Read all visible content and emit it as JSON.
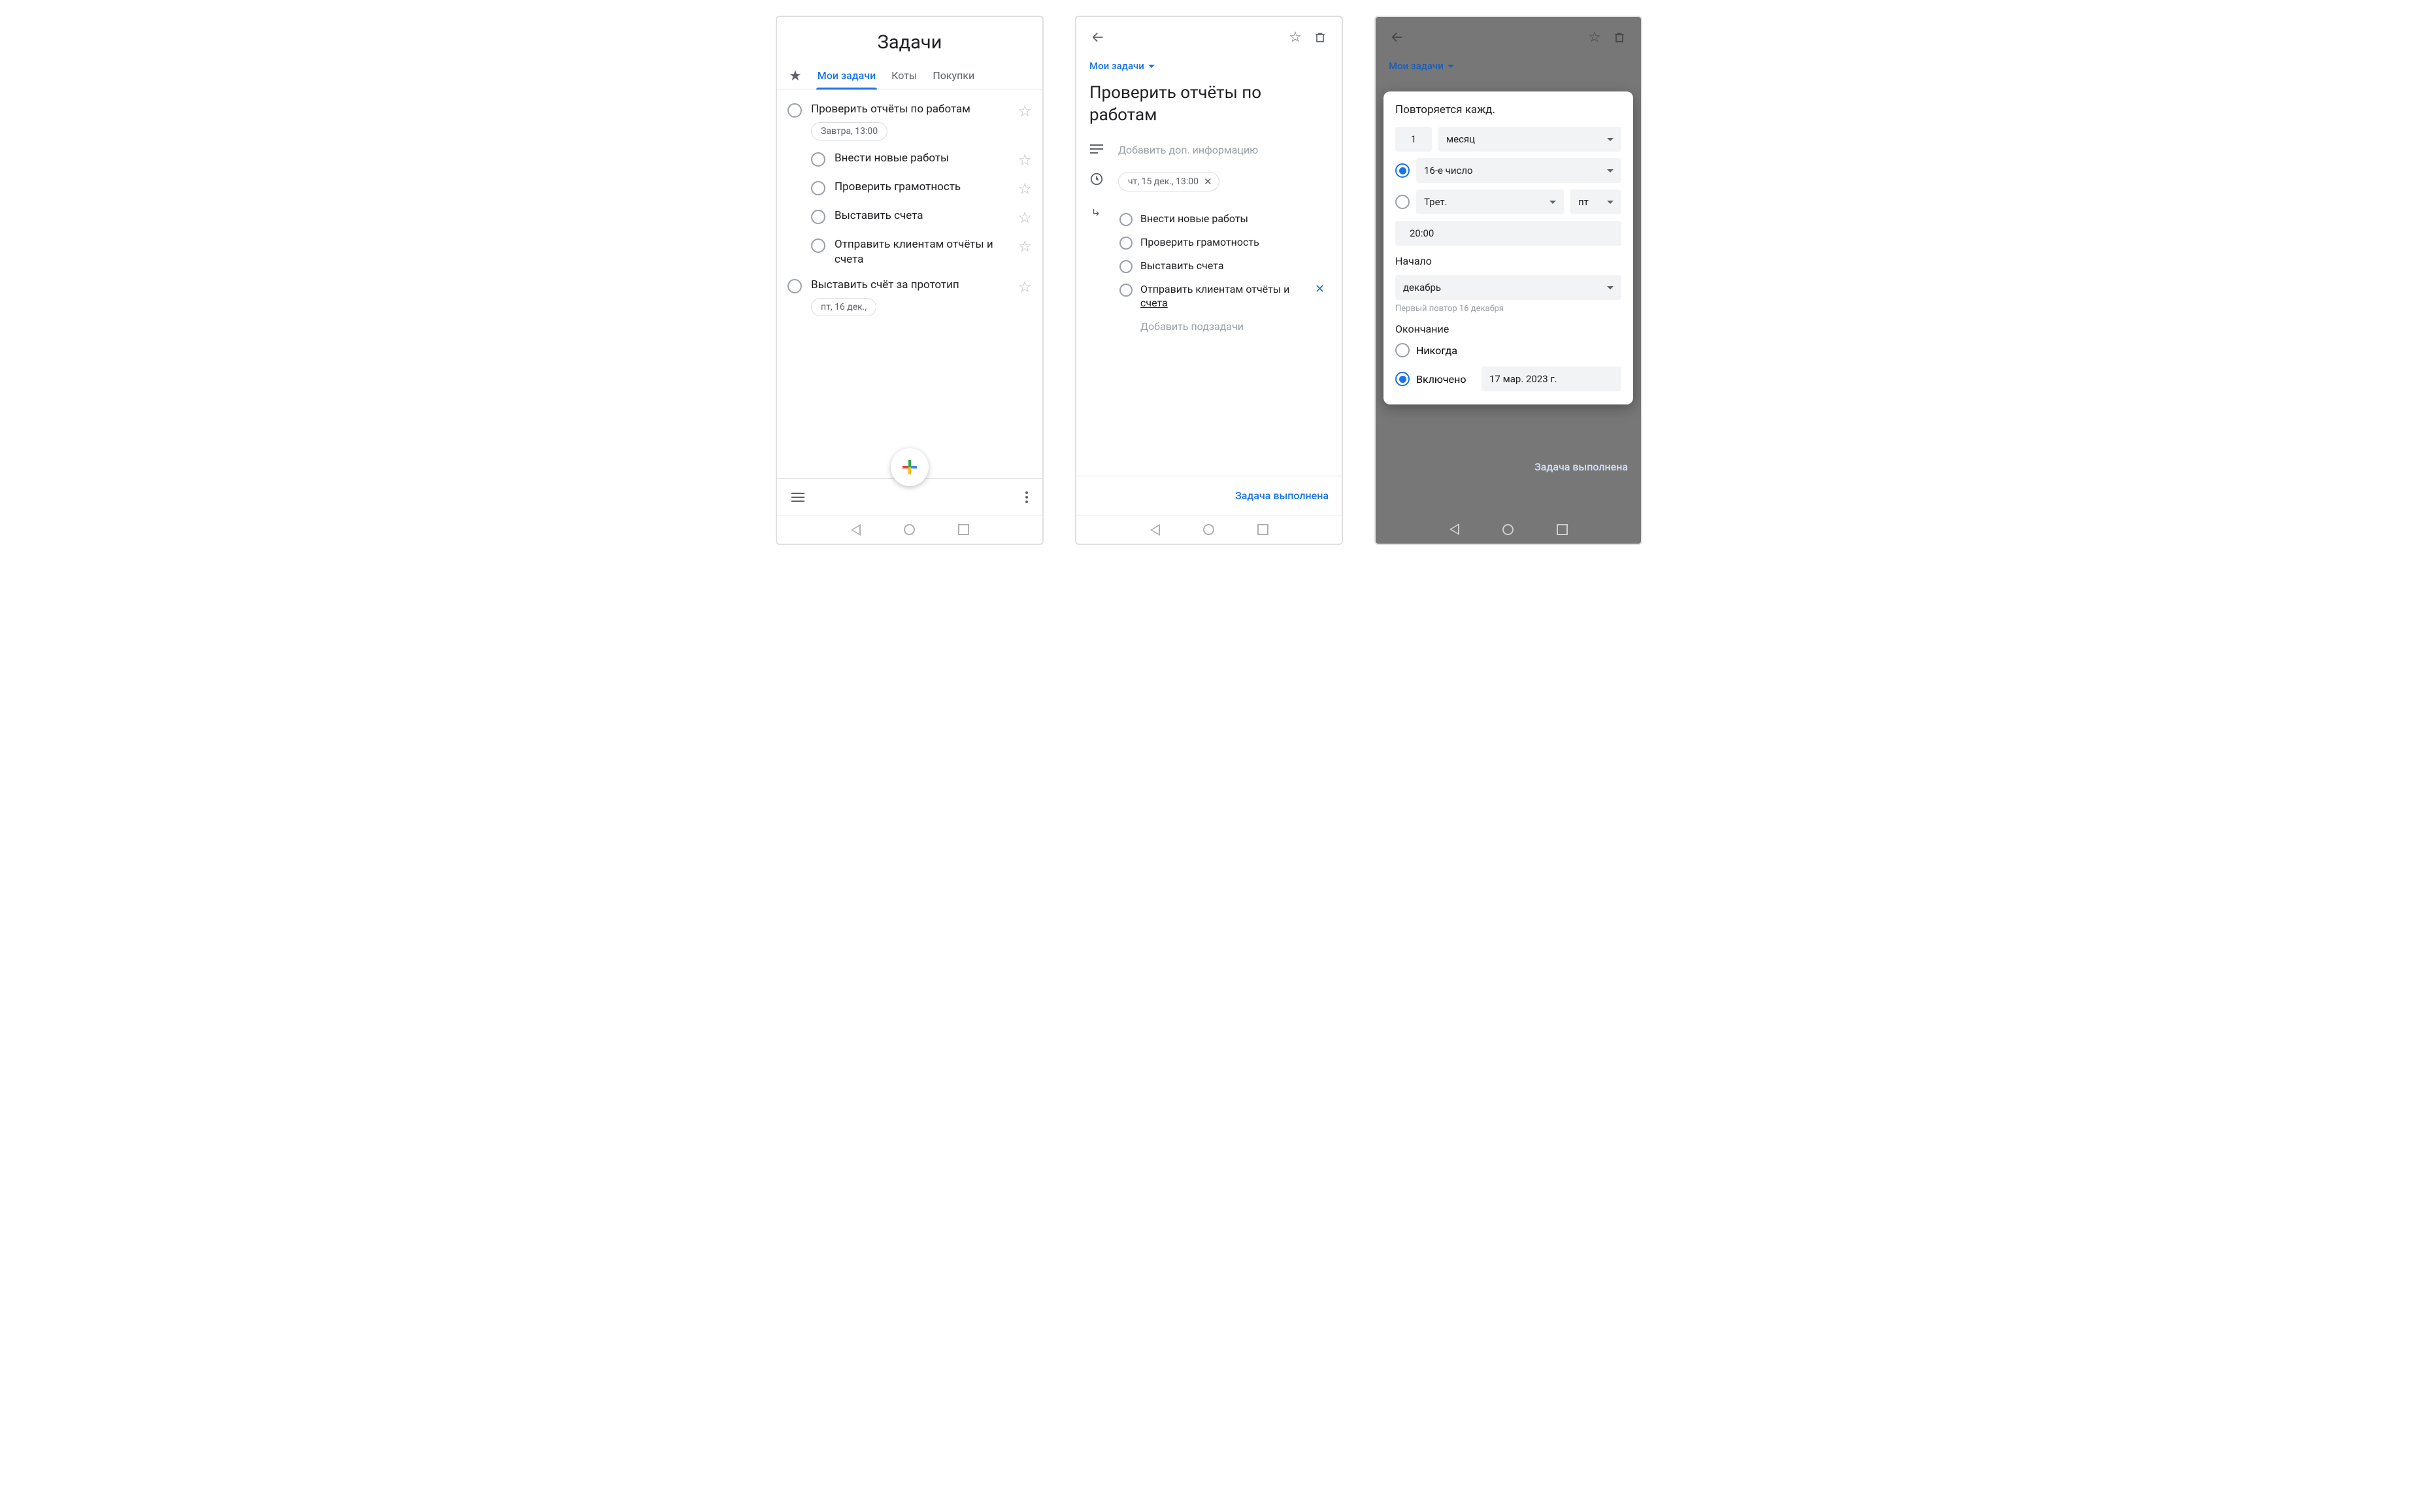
{
  "screen1": {
    "title": "Задачи",
    "tabs": [
      "Мои задачи",
      "Коты",
      "Покупки"
    ],
    "tasks": [
      {
        "title": "Проверить отчёты по работам",
        "chip": "Завтра, 13:00"
      },
      {
        "title": "Внести новые работы",
        "sub": true
      },
      {
        "title": "Проверить грамотность",
        "sub": true
      },
      {
        "title": "Выставить счета",
        "sub": true
      },
      {
        "title": "Отправить клиентам отчёты и счета",
        "sub": true
      },
      {
        "title": "Выставить счёт за прототип",
        "chip": "пт, 16 дек.,"
      }
    ]
  },
  "screen2": {
    "list_label": "Мои задачи",
    "title": "Проверить отчёты по работам",
    "notes_placeholder": "Добавить доп. информацию",
    "date_chip": "чт, 15 дек., 13:00",
    "subtasks": [
      "Внести новые работы",
      "Проверить грамотность",
      "Выставить счета"
    ],
    "subtask_last_pre": "Отправить клиентам отчёты и ",
    "subtask_last_underline": "счета",
    "add_subtask": "Добавить подзадачи",
    "done": "Задача выполнена"
  },
  "screen3": {
    "list_label": "Мои задачи",
    "sheet_title": "Повторяется кажд.",
    "interval_num": "1",
    "interval_unit": "месяц",
    "day_option": "16-е число",
    "ordinal_label": "Трет.",
    "weekday_label": "пт",
    "time_value": "20:00",
    "start_heading": "Начало",
    "start_month": "декабрь",
    "hint": "Первый повтор 16 декабря",
    "end_heading": "Окончание",
    "end_never": "Никогда",
    "end_on_label": "Включено",
    "end_on_date": "17 мар. 2023 г.",
    "done": "Задача выполнена"
  }
}
